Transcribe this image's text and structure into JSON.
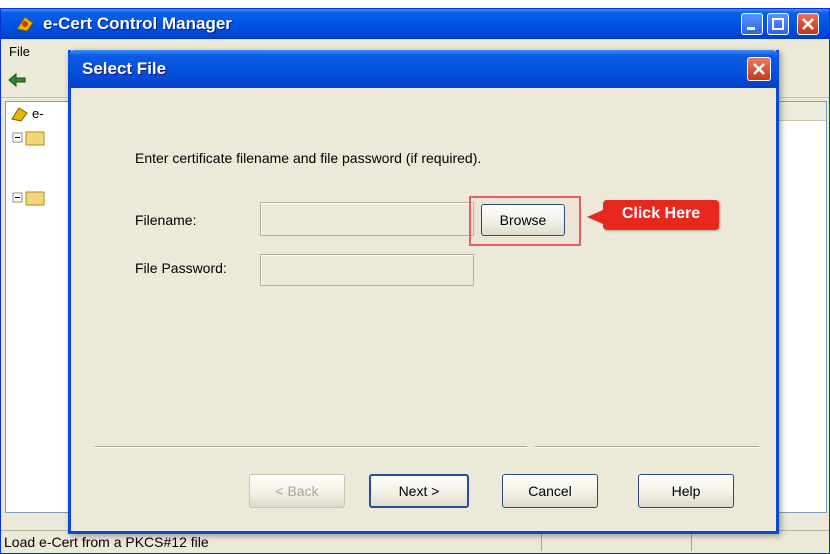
{
  "parent_window": {
    "title": "e-Cert Control Manager",
    "menu": {
      "file": "File"
    },
    "tree_root": "e-",
    "status_text": "Load e-Cert from a PKCS#12 file"
  },
  "dialog": {
    "title": "Select File",
    "instruction": "Enter certificate filename and file password (if required).",
    "filename_label": "Filename:",
    "password_label": "File Password:",
    "filename_value": "",
    "password_value": "",
    "browse_label": "Browse",
    "callout": "Click Here",
    "buttons": {
      "back": "< Back",
      "next": "Next >",
      "cancel": "Cancel",
      "help": "Help"
    }
  },
  "icons": [
    "app-icon",
    "minimize-icon",
    "maximize-icon",
    "close-icon",
    "back-arrow-icon",
    "folder-icon"
  ],
  "colors": {
    "titlebar": "#0453df",
    "callout": "#e8281e",
    "dialog_bg": "#ece9d8"
  }
}
